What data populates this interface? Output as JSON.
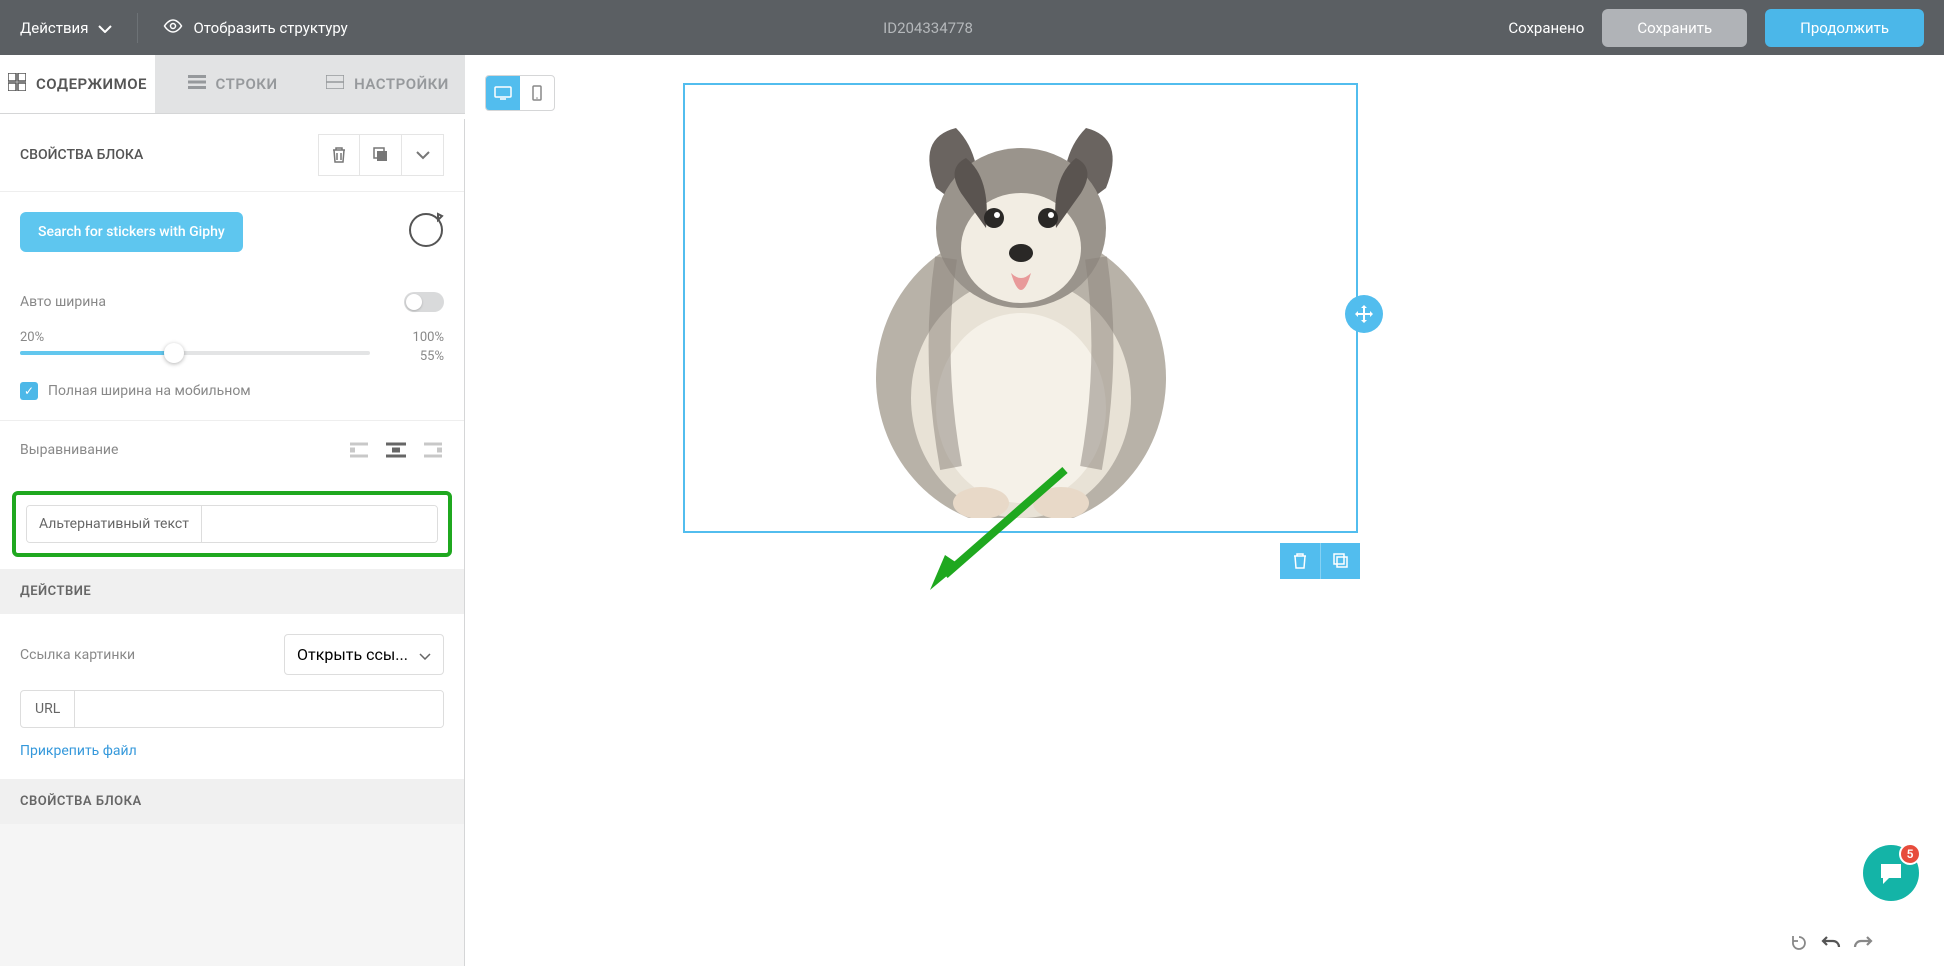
{
  "topbar": {
    "actions_label": "Действия",
    "show_structure": "Отобразить структуру",
    "doc_id": "ID204334778",
    "saved": "Сохранено",
    "save_btn": "Сохранить",
    "continue_btn": "Продолжить"
  },
  "tabs": {
    "content": "СОДЕРЖИМОЕ",
    "rows": "СТРОКИ",
    "settings": "НАСТРОЙКИ"
  },
  "block": {
    "properties_title": "СВОЙСТВА БЛОКА",
    "giphy_btn": "Search for stickers with Giphy",
    "auto_width": "Авто ширина",
    "min_pct": "20%",
    "max_pct": "100%",
    "cur_pct": "55%",
    "full_width_mobile": "Полная ширина на мобильном",
    "alignment": "Выравнивание",
    "alt_text_label": "Альтернативный текст",
    "action_header": "ДЕЙСТВИЕ",
    "image_link": "Ссылка картинки",
    "open_link": "Открыть ссы...",
    "url_label": "URL",
    "attach_file": "Прикрепить файл",
    "properties_footer": "СВОЙСТВА БЛОКА"
  },
  "chat": {
    "badge": "5"
  }
}
